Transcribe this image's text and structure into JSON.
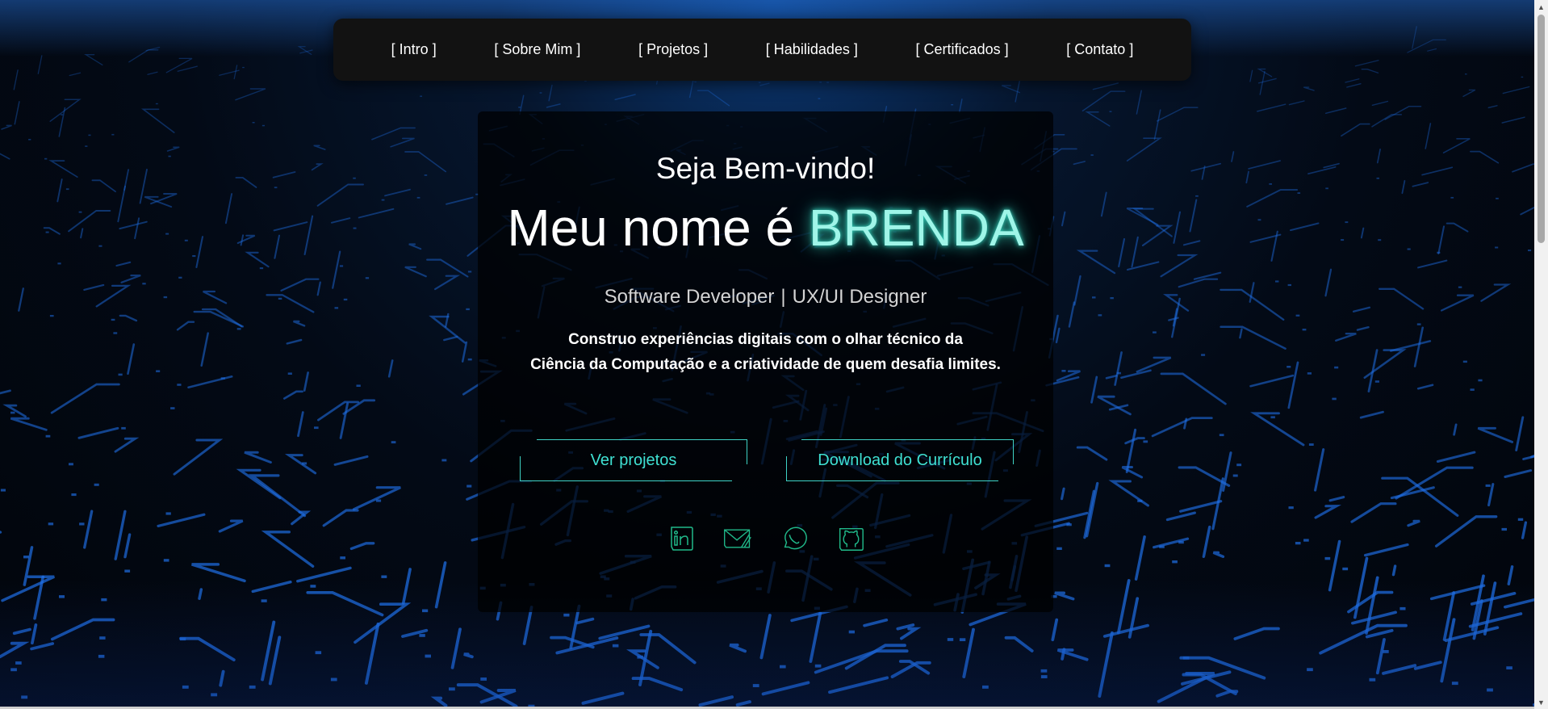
{
  "nav": {
    "items": [
      {
        "label": "[ Intro ]"
      },
      {
        "label": "[ Sobre Mim ]"
      },
      {
        "label": "[ Projetos ]"
      },
      {
        "label": "[ Habilidades ]"
      },
      {
        "label": "[ Certificados ]"
      },
      {
        "label": "[ Contato ]"
      }
    ]
  },
  "hero": {
    "greeting": "Seja Bem-vindo!",
    "name_prefix": "Meu nome é",
    "name": "BRENDA",
    "role_1": "Software Developer",
    "role_separator": "|",
    "role_2": "UX/UI Designer",
    "tagline_line_1": "Construo experiências digitais com o olhar técnico da",
    "tagline_line_2": "Ciência da Computação e a criatividade de quem desafia limites."
  },
  "buttons": {
    "projects_label": "Ver projetos",
    "cv_label": "Download do Currículo"
  },
  "socials": {
    "icons": [
      "linkedin-icon",
      "email-icon",
      "whatsapp-icon",
      "github-icon"
    ]
  },
  "colors": {
    "accent": "#3fe0d2",
    "name_glow": "#9ff5e8",
    "nav_background": "#121212",
    "circuit_blue": "#1f6fe6"
  }
}
